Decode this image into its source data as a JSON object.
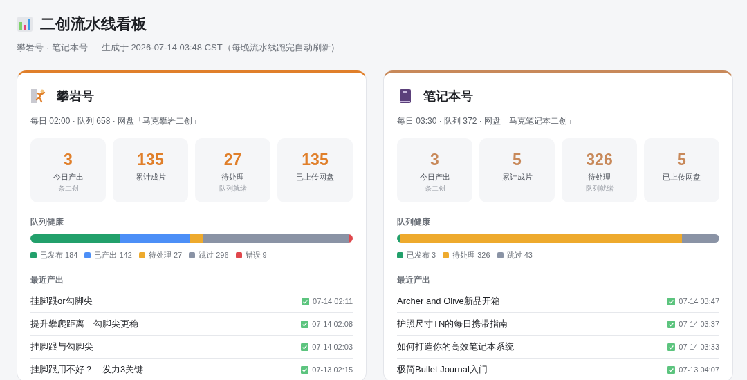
{
  "header": {
    "title": "二创流水线看板",
    "subtitle": "攀岩号 · 笔记本号 — 生成于 2026-07-14 03:48 CST（每晚流水线跑完自动刷新）"
  },
  "accounts": [
    {
      "kind": "climber",
      "name": "攀岩号",
      "color": "#e07f2a",
      "meta": "每日 02:00 · 队列 658 · 网盘「马克攀岩二创」",
      "stats": [
        {
          "value": "3",
          "label": "今日产出",
          "note": "条二创"
        },
        {
          "value": "135",
          "label": "累计成片"
        },
        {
          "value": "27",
          "label": "待处理",
          "note": "队列就绪"
        },
        {
          "value": "135",
          "label": "已上传网盘"
        }
      ],
      "health_title": "队列健康",
      "health": [
        {
          "label": "已发布",
          "count": "184",
          "color": "#22a06b"
        },
        {
          "label": "已产出",
          "count": "142",
          "color": "#4c8ff7"
        },
        {
          "label": "待处理",
          "count": "27",
          "color": "#eeaa2d"
        },
        {
          "label": "跳过",
          "count": "296",
          "color": "#8a93a5"
        },
        {
          "label": "错误",
          "count": "9",
          "color": "#e0474c"
        }
      ],
      "recent_title": "最近产出",
      "recent": [
        {
          "title": "挂脚跟or勾脚尖",
          "time": "07-14 02:11"
        },
        {
          "title": "提升攀爬距离｜勾脚尖更稳",
          "time": "07-14 02:08"
        },
        {
          "title": "挂脚跟与勾脚尖",
          "time": "07-14 02:03"
        },
        {
          "title": "挂脚跟用不好？｜发力3关键",
          "time": "07-13 02:15"
        }
      ]
    },
    {
      "kind": "notebook",
      "name": "笔记本号",
      "color": "#c8895a",
      "meta": "每日 03:30 · 队列 372 · 网盘「马克笔记本二创」",
      "stats": [
        {
          "value": "3",
          "label": "今日产出",
          "note": "条二创"
        },
        {
          "value": "5",
          "label": "累计成片"
        },
        {
          "value": "326",
          "label": "待处理",
          "note": "队列就绪"
        },
        {
          "value": "5",
          "label": "已上传网盘"
        }
      ],
      "health_title": "队列健康",
      "health": [
        {
          "label": "已发布",
          "count": "3",
          "color": "#22a06b"
        },
        {
          "label": "待处理",
          "count": "326",
          "color": "#eeaa2d"
        },
        {
          "label": "跳过",
          "count": "43",
          "color": "#8a93a5"
        }
      ],
      "recent_title": "最近产出",
      "recent": [
        {
          "title": "Archer and Olive新品开箱",
          "time": "07-14 03:47"
        },
        {
          "title": "护照尺寸TN的每日携带指南",
          "time": "07-14 03:37"
        },
        {
          "title": "如何打造你的高效笔记本系统",
          "time": "07-14 03:33"
        },
        {
          "title": "极简Bullet Journal入门",
          "time": "07-13 04:07"
        }
      ]
    }
  ]
}
